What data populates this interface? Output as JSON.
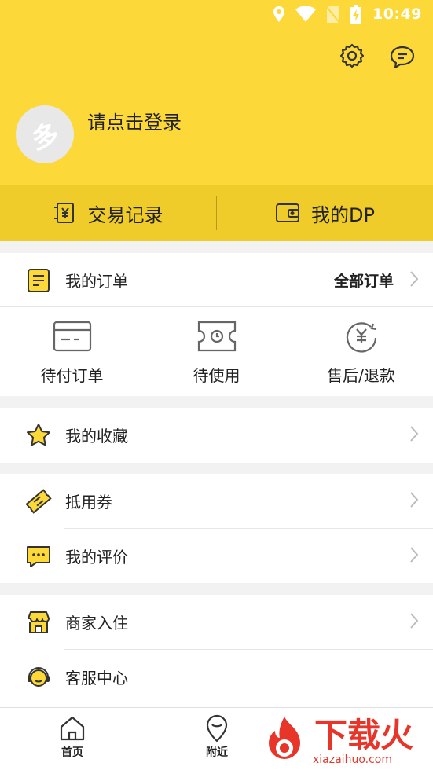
{
  "status_bar": {
    "time": "10:49"
  },
  "header": {
    "login_prompt": "请点击登录",
    "avatar_glyph": "多",
    "icons": [
      "settings-icon",
      "message-icon"
    ]
  },
  "quick_actions": [
    {
      "label": "交易记录",
      "icon": "yen-receipt-icon"
    },
    {
      "label": "我的DP",
      "icon": "wallet-icon"
    }
  ],
  "orders": {
    "title": "我的订单",
    "all_link": "全部订单",
    "subitems": [
      {
        "label": "待付订单",
        "icon": "card-icon"
      },
      {
        "label": "待使用",
        "icon": "ticket-clock-icon"
      },
      {
        "label": "售后/退款",
        "icon": "refund-icon"
      }
    ]
  },
  "menu": {
    "favorites": "我的收藏",
    "coupons": "抵用券",
    "reviews": "我的评价",
    "merchant": "商家入住",
    "service": "客服中心"
  },
  "tabbar": [
    {
      "label": "首页",
      "icon": "home-icon"
    },
    {
      "label": "附近",
      "icon": "location-icon"
    }
  ],
  "watermark": {
    "brand": "下载火",
    "url": "xiazaihuo.com"
  },
  "colors": {
    "brand_yellow": "#fcd838",
    "quickbar_yellow": "#efcc2a",
    "watermark_red": "#e8352a"
  }
}
